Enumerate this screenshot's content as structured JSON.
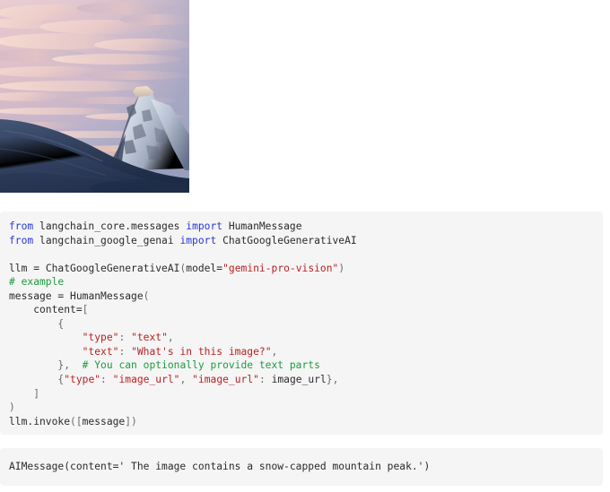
{
  "photo": {
    "alt": "snow-capped mountain peak at sunset",
    "sky_top_color": "#e7cbd0",
    "sky_mid_color": "#d9b8c4",
    "cloud_color": "#f3d6cf",
    "sky_low_color": "#a8a6c2",
    "snow_foreground_color": "#2e3e5c",
    "snow_foreground_dark": "#22304c",
    "peak_snow_color": "#d7dde8",
    "peak_rock_color": "#6a7285"
  },
  "code": {
    "language": "python",
    "background": "#f5f5f5",
    "colors": {
      "keyword": "#2838d4",
      "string": "#ba2121",
      "comment": "#1f9b3f",
      "punctuation": "#6b6b6b",
      "text": "#2b2b2b"
    },
    "lines": [
      {
        "id": "line-1",
        "tokens": [
          {
            "t": "from",
            "c": "k"
          },
          {
            "t": " langchain_core.messages ",
            "c": "n"
          },
          {
            "t": "import",
            "c": "k"
          },
          {
            "t": " HumanMessage",
            "c": "n"
          }
        ]
      },
      {
        "id": "line-2",
        "tokens": [
          {
            "t": "from",
            "c": "k"
          },
          {
            "t": " langchain_google_genai ",
            "c": "n"
          },
          {
            "t": "import",
            "c": "k"
          },
          {
            "t": " ChatGoogleGenerativeAI",
            "c": "n"
          }
        ]
      },
      {
        "id": "line-3",
        "tokens": []
      },
      {
        "id": "line-4",
        "tokens": [
          {
            "t": "llm ",
            "c": "n"
          },
          {
            "t": "=",
            "c": "o"
          },
          {
            "t": " ChatGoogleGenerativeAI",
            "c": "n"
          },
          {
            "t": "(",
            "c": "p"
          },
          {
            "t": "model",
            "c": "n"
          },
          {
            "t": "=",
            "c": "o"
          },
          {
            "t": "\"gemini-pro-vision\"",
            "c": "s"
          },
          {
            "t": ")",
            "c": "p"
          }
        ]
      },
      {
        "id": "line-5",
        "tokens": [
          {
            "t": "# example",
            "c": "c"
          }
        ]
      },
      {
        "id": "line-6",
        "tokens": [
          {
            "t": "message ",
            "c": "n"
          },
          {
            "t": "=",
            "c": "o"
          },
          {
            "t": " HumanMessage",
            "c": "n"
          },
          {
            "t": "(",
            "c": "p"
          }
        ]
      },
      {
        "id": "line-7",
        "tokens": [
          {
            "t": "    content",
            "c": "n"
          },
          {
            "t": "=",
            "c": "o"
          },
          {
            "t": "[",
            "c": "p"
          }
        ]
      },
      {
        "id": "line-8",
        "tokens": [
          {
            "t": "        ",
            "c": "n"
          },
          {
            "t": "{",
            "c": "p"
          }
        ]
      },
      {
        "id": "line-9",
        "tokens": [
          {
            "t": "            ",
            "c": "n"
          },
          {
            "t": "\"type\"",
            "c": "s"
          },
          {
            "t": ":",
            "c": "p"
          },
          {
            "t": " ",
            "c": "n"
          },
          {
            "t": "\"text\"",
            "c": "s"
          },
          {
            "t": ",",
            "c": "p"
          }
        ]
      },
      {
        "id": "line-10",
        "tokens": [
          {
            "t": "            ",
            "c": "n"
          },
          {
            "t": "\"text\"",
            "c": "s"
          },
          {
            "t": ":",
            "c": "p"
          },
          {
            "t": " ",
            "c": "n"
          },
          {
            "t": "\"What's in this image?\"",
            "c": "s"
          },
          {
            "t": ",",
            "c": "p"
          }
        ]
      },
      {
        "id": "line-11",
        "tokens": [
          {
            "t": "        ",
            "c": "n"
          },
          {
            "t": "},",
            "c": "p"
          },
          {
            "t": "  ",
            "c": "n"
          },
          {
            "t": "# You can optionally provide text parts",
            "c": "c"
          }
        ]
      },
      {
        "id": "line-12",
        "tokens": [
          {
            "t": "        ",
            "c": "n"
          },
          {
            "t": "{",
            "c": "p"
          },
          {
            "t": "\"type\"",
            "c": "s"
          },
          {
            "t": ":",
            "c": "p"
          },
          {
            "t": " ",
            "c": "n"
          },
          {
            "t": "\"image_url\"",
            "c": "s"
          },
          {
            "t": ",",
            "c": "p"
          },
          {
            "t": " ",
            "c": "n"
          },
          {
            "t": "\"image_url\"",
            "c": "s"
          },
          {
            "t": ":",
            "c": "p"
          },
          {
            "t": " image_url",
            "c": "n"
          },
          {
            "t": "},",
            "c": "p"
          }
        ]
      },
      {
        "id": "line-13",
        "tokens": [
          {
            "t": "    ",
            "c": "n"
          },
          {
            "t": "]",
            "c": "p"
          }
        ]
      },
      {
        "id": "line-14",
        "tokens": [
          {
            "t": ")",
            "c": "p"
          }
        ]
      },
      {
        "id": "line-15",
        "tokens": [
          {
            "t": "llm.invoke",
            "c": "n"
          },
          {
            "t": "([",
            "c": "p"
          },
          {
            "t": "message",
            "c": "n"
          },
          {
            "t": "])",
            "c": "p"
          }
        ]
      }
    ]
  },
  "output": {
    "text": "AIMessage(content=' The image contains a snow-capped mountain peak.')"
  }
}
